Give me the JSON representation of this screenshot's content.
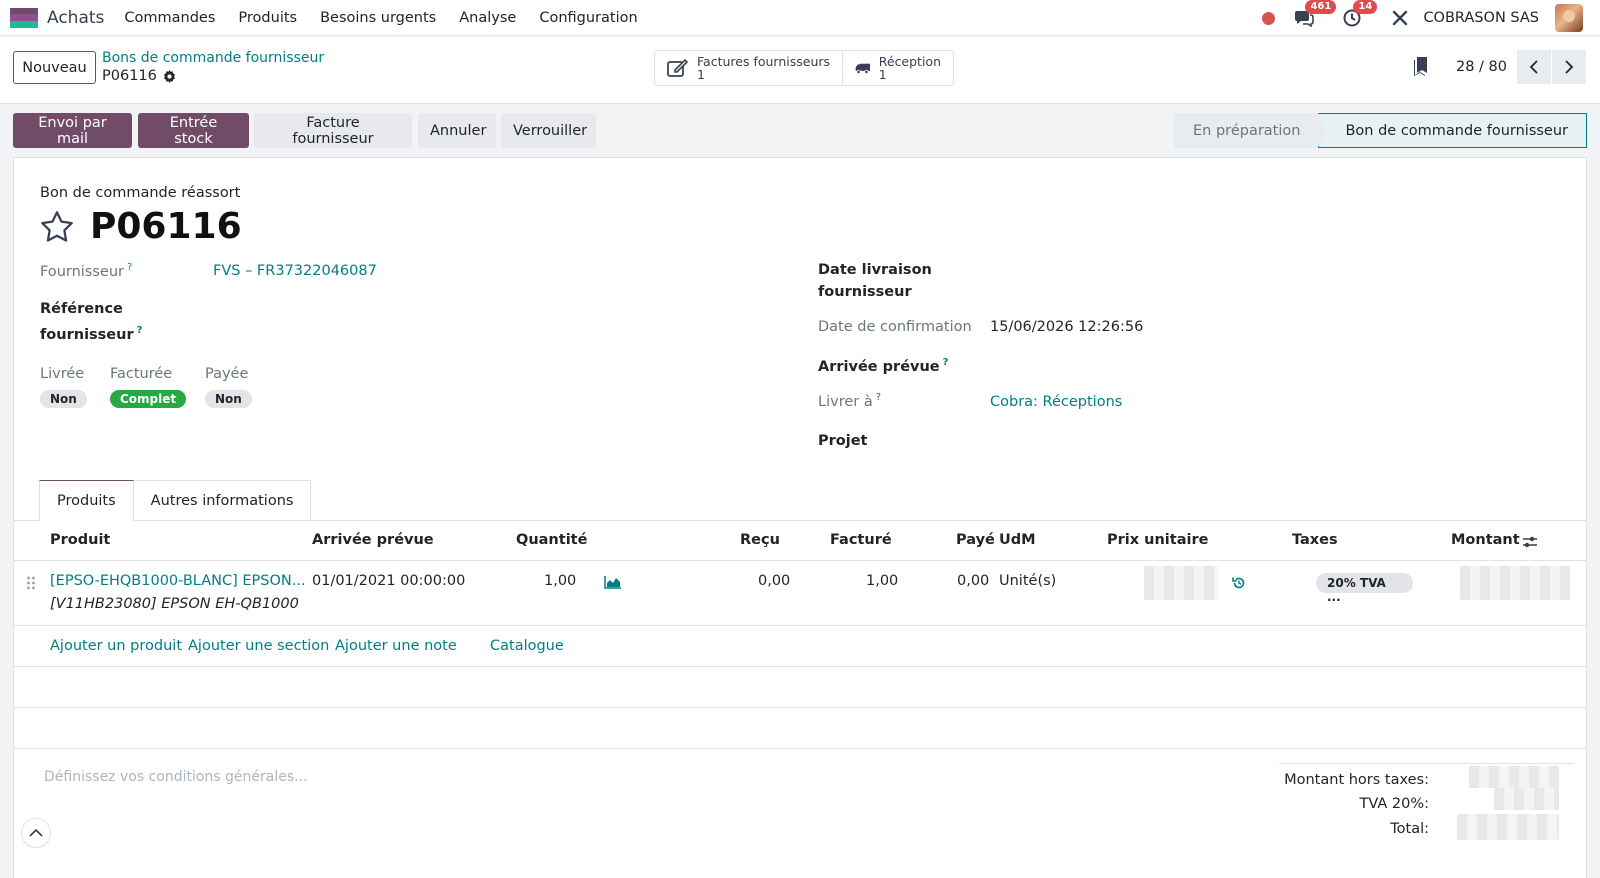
{
  "topnav": {
    "app_name": "Achats",
    "menu": [
      "Commandes",
      "Produits",
      "Besoins urgents",
      "Analyse",
      "Configuration"
    ],
    "messages_count": "461",
    "activities_count": "14",
    "company": "COBRASON SAS"
  },
  "control": {
    "new_label": "Nouveau",
    "breadcrumb_parent": "Bons de commande fournisseur",
    "breadcrumb_current": "P06116",
    "smart_buttons": [
      {
        "label": "Factures fournisseurs",
        "count": "1",
        "icon": "pencil-square-icon"
      },
      {
        "label": "Réception",
        "count": "1",
        "icon": "truck-icon"
      }
    ],
    "pager": "28 / 80"
  },
  "actions": {
    "send_mail": "Envoi par mail",
    "stock_entry": "Entrée stock",
    "vendor_bill": "Facture fournisseur",
    "cancel": "Annuler",
    "lock": "Verrouiller"
  },
  "status": {
    "stage_draft": "En préparation",
    "stage_current": "Bon de commande fournisseur"
  },
  "form": {
    "subtitle": "Bon de commande réassort",
    "title": "P06116",
    "vendor_label": "Fournisseur",
    "vendor_value": "FVS – FR37322046087",
    "vendor_ref_label_1": "Référence",
    "vendor_ref_label_2": "fournisseur",
    "delivered_label": "Livrée",
    "delivered_value": "Non",
    "invoiced_label": "Facturée",
    "invoiced_value": "Complet",
    "paid_label": "Payée",
    "paid_value": "Non",
    "delivery_date_label_1": "Date livraison",
    "delivery_date_label_2": "fournisseur",
    "confirm_date_label": "Date de confirmation",
    "confirm_date_value": "15/06/2026 12:26:56",
    "expected_label": "Arrivée prévue",
    "deliver_to_label": "Livrer à",
    "deliver_to_value": "Cobra: Réceptions",
    "project_label": "Projet"
  },
  "tabs": [
    "Produits",
    "Autres informations"
  ],
  "table": {
    "headers": {
      "product": "Produit",
      "expected": "Arrivée prévue",
      "quantity": "Quantité",
      "received": "Reçu",
      "invoiced": "Facturé",
      "paid": "Payé",
      "uom": "UdM",
      "unit_price": "Prix unitaire",
      "taxes": "Taxes",
      "amount": "Montant"
    },
    "rows": [
      {
        "product": "[EPSO-EHQB1000-BLANC] EPSON...",
        "description": "[V11HB23080] EPSON EH-QB1000",
        "expected": "01/01/2021 00:00:00",
        "quantity": "1,00",
        "received": "0,00",
        "invoiced": "1,00",
        "paid": "0,00",
        "uom": "Unité(s)",
        "taxes": "20% TVA ..."
      }
    ],
    "add_links": {
      "product": "Ajouter un produit",
      "section": "Ajouter une section",
      "note": "Ajouter une note",
      "catalog": "Catalogue"
    }
  },
  "footer": {
    "terms_placeholder": "Définissez vos conditions générales...",
    "untaxed_label": "Montant hors taxes:",
    "vat_label": "TVA 20%:",
    "total_label": "Total:"
  },
  "colors": {
    "brand": "#714b67",
    "link": "#017e84",
    "success": "#28a745",
    "danger": "#e04b4b"
  }
}
